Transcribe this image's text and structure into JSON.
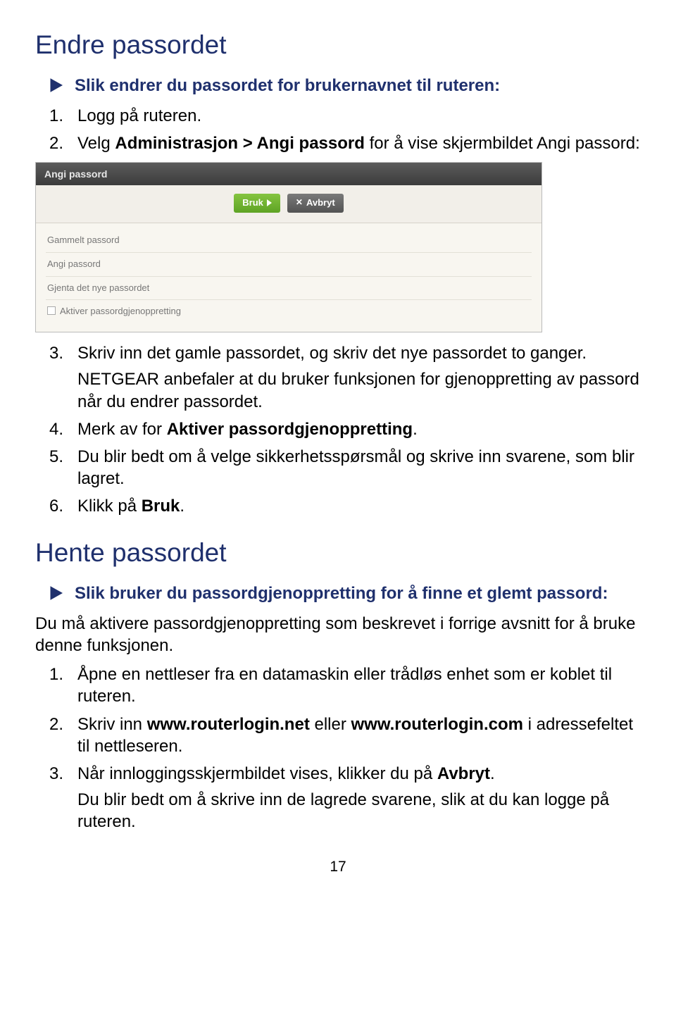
{
  "h1": "Endre passordet",
  "arrow1": "Slik endrer du passordet for brukernavnet til ruteren:",
  "steps1": {
    "s1": {
      "n": "1.",
      "t": "Logg på ruteren."
    },
    "s2": {
      "n": "2.",
      "prefix": "Velg ",
      "bold": "Administrasjon > Angi passord",
      "suffix": " for å vise skjermbildet Angi passord:"
    },
    "s3": {
      "n": "3.",
      "line1": "Skriv inn det gamle passordet, og skriv det nye passordet to ganger.",
      "line2": "NETGEAR anbefaler at du bruker funksjonen for gjenoppretting av passord når du endrer passordet."
    },
    "s4": {
      "n": "4.",
      "prefix": "Merk av for ",
      "bold": "Aktiver passordgjenoppretting",
      "suffix": "."
    },
    "s5": {
      "n": "5.",
      "t": "Du blir bedt om å velge sikkerhetsspørsmål og skrive inn svarene, som blir lagret."
    },
    "s6": {
      "n": "6.",
      "prefix": "Klikk på ",
      "bold": "Bruk",
      "suffix": "."
    }
  },
  "shot": {
    "title": "Angi passord",
    "apply": "Bruk",
    "cancel": "Avbryt",
    "f1": "Gammelt passord",
    "f2": "Angi passord",
    "f3": "Gjenta det nye passordet",
    "f4": "Aktiver passordgjenoppretting"
  },
  "h2": "Hente passordet",
  "arrow2": "Slik bruker du passordgjenoppretting for å finne et glemt passord:",
  "para2": "Du må aktivere passordgjenoppretting som beskrevet i forrige avsnitt for å bruke denne funksjonen.",
  "steps2": {
    "s1": {
      "n": "1.",
      "t": "Åpne en nettleser fra en datamaskin eller trådløs enhet som er koblet til ruteren."
    },
    "s2": {
      "n": "2.",
      "prefix": "Skriv inn ",
      "bold1": "www.routerlogin.net",
      "mid": " eller ",
      "bold2": "www.routerlogin.com",
      "suffix": " i adressefeltet til nettleseren."
    },
    "s3": {
      "n": "3.",
      "prefix": "Når innloggingsskjermbildet vises, klikker du på ",
      "bold": "Avbryt",
      "suffix": ".",
      "line2": "Du blir bedt om å skrive inn de lagrede svarene, slik at du kan logge på ruteren."
    }
  },
  "page_num": "17"
}
